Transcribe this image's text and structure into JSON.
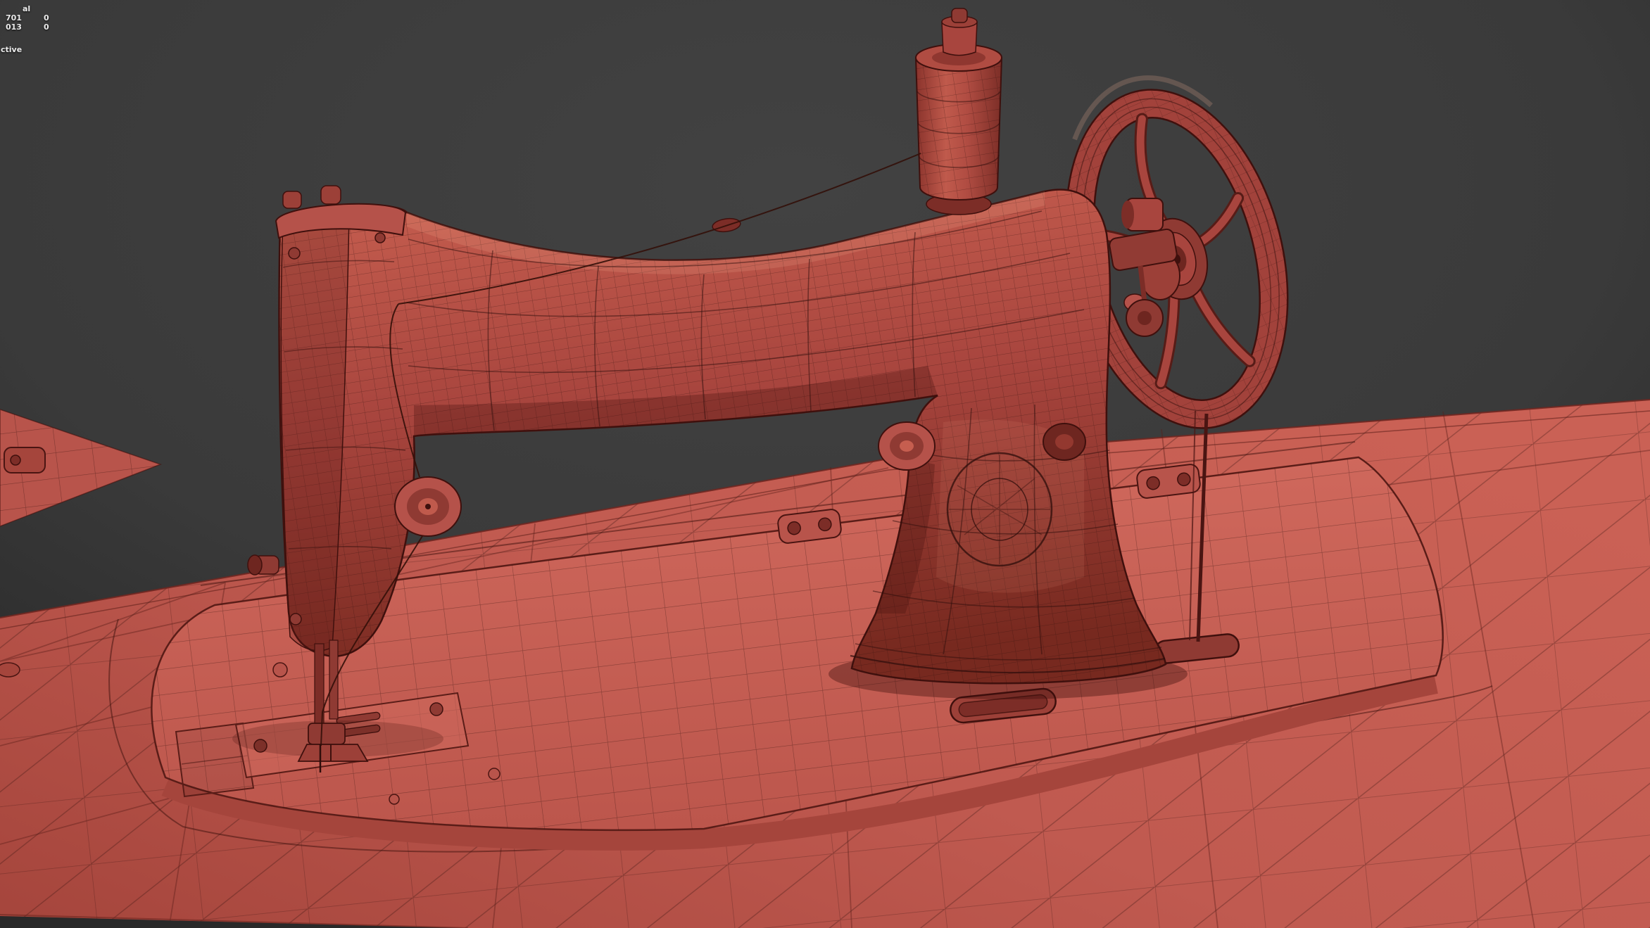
{
  "stats_overlay": {
    "line1": "al",
    "line2_label": "701",
    "line2_value": "0",
    "line3_label": "013",
    "line3_value": "0",
    "line4": "ctive"
  },
  "colors": {
    "background_center": "#424242",
    "background_edge": "#232323",
    "body_highlight": "#c65e4f",
    "body_base": "#a8453e",
    "body_shadow": "#77291f",
    "platform_light": "#cf685c",
    "platform_base": "#c05a50",
    "platform_dark": "#a5453c",
    "wheel_rim": "#a2423b",
    "outline": "#3f100d",
    "stats_text": "#ececec"
  }
}
